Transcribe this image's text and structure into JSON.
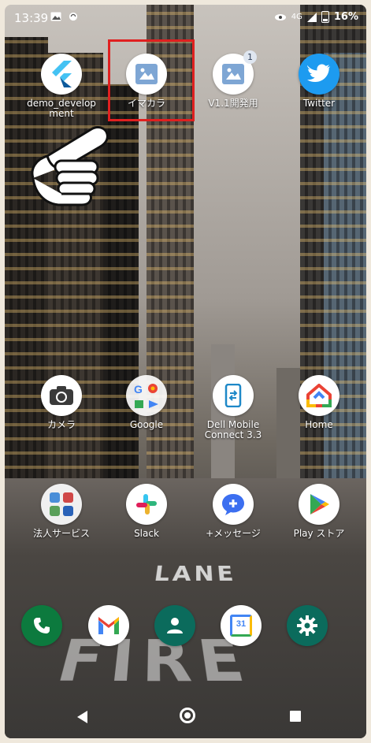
{
  "status_bar": {
    "time": "13:39",
    "network": "4G",
    "battery": "16%"
  },
  "home": {
    "row1": [
      {
        "label": "demo_develop\nment",
        "icon": "flutter-icon"
      },
      {
        "label": "イマカラ",
        "icon": "imakara-icon"
      },
      {
        "label": "V1.1開発用",
        "icon": "imakara-dev-icon",
        "badge": "1"
      },
      {
        "label": "Twitter",
        "icon": "twitter-bird-icon"
      }
    ],
    "row2": [
      {
        "label": "カメラ",
        "icon": "camera-icon"
      },
      {
        "label": "Google",
        "icon": "google-folder-icon"
      },
      {
        "label": "Dell Mobile\nConnect 3.3",
        "icon": "dell-mobile-connect-icon"
      },
      {
        "label": "Home",
        "icon": "google-home-icon"
      }
    ],
    "row3": [
      {
        "label": "法人サービス",
        "icon": "business-service-icon"
      },
      {
        "label": "Slack",
        "icon": "slack-icon"
      },
      {
        "label": "+メッセージ",
        "icon": "plus-message-icon"
      },
      {
        "label": "Play ストア",
        "icon": "play-store-icon"
      }
    ],
    "dock": [
      {
        "icon": "phone-icon"
      },
      {
        "icon": "gmail-icon"
      },
      {
        "icon": "contacts-icon"
      },
      {
        "icon": "calendar-icon",
        "text": "31"
      },
      {
        "icon": "settings-gear-icon"
      }
    ]
  },
  "wallpaper": {
    "road_text_1": "LANE",
    "road_text_2": "FIRE"
  },
  "colors": {
    "highlight": "#e02020",
    "twitter": "#1d9bf0",
    "phone": "#0c7a3e",
    "settings": "#0b6b5c"
  }
}
